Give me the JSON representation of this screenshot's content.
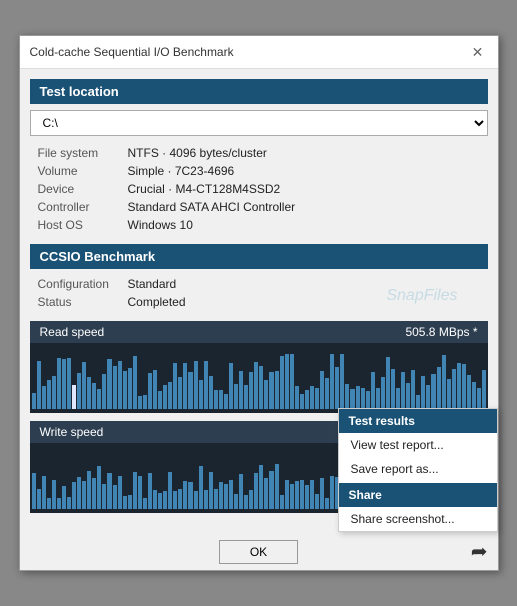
{
  "window": {
    "title": "Cold-cache Sequential I/O Benchmark",
    "close_label": "✕"
  },
  "test_location": {
    "header": "Test location",
    "drive": "C:\\",
    "fields": [
      {
        "label": "File system",
        "value": "NTFS  ·  4096 bytes/cluster"
      },
      {
        "label": "Volume",
        "value": "Simple  ·  7C23-4696"
      },
      {
        "label": "Device",
        "value": "Crucial  ·  M4-CT128M4SSD2"
      },
      {
        "label": "Controller",
        "value": "Standard SATA AHCI Controller"
      },
      {
        "label": "Host OS",
        "value": "Windows 10"
      }
    ]
  },
  "benchmark": {
    "header": "CCSIO Benchmark",
    "fields": [
      {
        "label": "Configuration",
        "value": "Standard"
      },
      {
        "label": "Status",
        "value": "Completed"
      }
    ],
    "watermark": "SnapFiles"
  },
  "read_speed": {
    "header": "Read speed",
    "value": "505.8 MBps *"
  },
  "write_speed": {
    "header": "Write speed"
  },
  "footer": {
    "ok_label": "OK"
  },
  "context_menu": {
    "results_header": "Test results",
    "view_report": "View test report...",
    "save_report": "Save report as...",
    "share_header": "Share",
    "share_screenshot": "Share screenshot..."
  }
}
